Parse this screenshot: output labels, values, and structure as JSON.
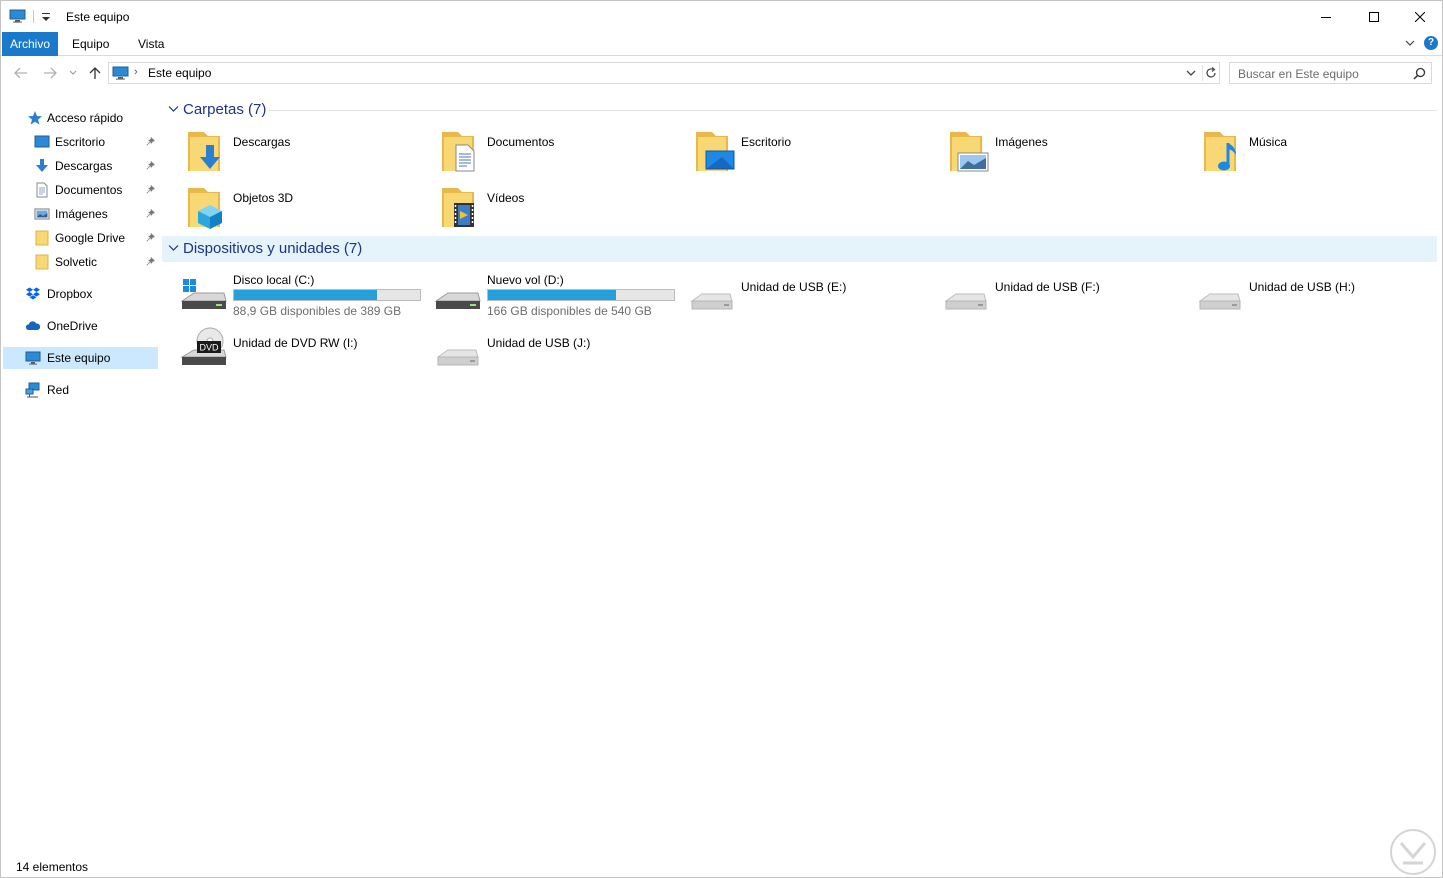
{
  "window": {
    "title": "Este equipo",
    "controls": {
      "minimize": "minimize-icon",
      "maximize": "maximize-icon",
      "close": "close-icon"
    }
  },
  "ribbon": {
    "tabs": [
      {
        "label": "Archivo",
        "active": true
      },
      {
        "label": "Equipo"
      },
      {
        "label": "Vista"
      }
    ],
    "help": "?"
  },
  "address": {
    "path_separator": "›",
    "location": "Este equipo",
    "search_placeholder": "Buscar en Este equipo"
  },
  "sidebar": {
    "items": [
      {
        "label": "Acceso rápido",
        "icon": "star-icon"
      },
      {
        "label": "Escritorio",
        "icon": "desktop-icon",
        "pinned": true
      },
      {
        "label": "Descargas",
        "icon": "download-icon",
        "pinned": true
      },
      {
        "label": "Documentos",
        "icon": "document-icon",
        "pinned": true
      },
      {
        "label": "Imágenes",
        "icon": "pictures-icon",
        "pinned": true
      },
      {
        "label": "Google Drive",
        "icon": "folder-icon",
        "pinned": true
      },
      {
        "label": "Solvetic",
        "icon": "folder-icon",
        "pinned": true
      },
      {
        "label": "Dropbox",
        "icon": "dropbox-icon"
      },
      {
        "label": "OneDrive",
        "icon": "cloud-icon"
      },
      {
        "label": "Este equipo",
        "icon": "computer-icon",
        "selected": true
      },
      {
        "label": "Red",
        "icon": "network-icon"
      }
    ]
  },
  "folders": {
    "header": "Carpetas (7)",
    "items": [
      {
        "label": "Descargas",
        "icon": "downloads-folder-icon"
      },
      {
        "label": "Documentos",
        "icon": "documents-folder-icon"
      },
      {
        "label": "Escritorio",
        "icon": "desktop-folder-icon"
      },
      {
        "label": "Imágenes",
        "icon": "pictures-folder-icon"
      },
      {
        "label": "Música",
        "icon": "music-folder-icon"
      },
      {
        "label": "Objetos 3D",
        "icon": "3d-objects-folder-icon"
      },
      {
        "label": "Vídeos",
        "icon": "videos-folder-icon"
      }
    ]
  },
  "devices": {
    "header": "Dispositivos y unidades (7)",
    "items": [
      {
        "label": "Disco local (C:)",
        "free_text": "88,9 GB disponibles de 389 GB",
        "used_fraction": 0.77,
        "icon": "windows-drive-icon"
      },
      {
        "label": "Nuevo vol (D:)",
        "free_text": "166 GB disponibles de 540 GB",
        "used_fraction": 0.69,
        "icon": "hard-drive-icon"
      },
      {
        "label": "Unidad de USB (E:)",
        "icon": "usb-drive-icon"
      },
      {
        "label": "Unidad de USB (F:)",
        "icon": "usb-drive-icon"
      },
      {
        "label": "Unidad de USB (H:)",
        "icon": "usb-drive-icon"
      },
      {
        "label": "Unidad de DVD RW (I:)",
        "icon": "dvd-drive-icon",
        "badge": "DVD"
      },
      {
        "label": "Unidad de USB (J:)",
        "icon": "usb-drive-icon"
      }
    ]
  },
  "status": {
    "count": "14 elementos"
  },
  "colors": {
    "accent": "#1979ca",
    "selection": "#cce8ff",
    "bar_fill": "#26a0da",
    "folder": "#f8d775",
    "header_text": "#1e3287"
  }
}
